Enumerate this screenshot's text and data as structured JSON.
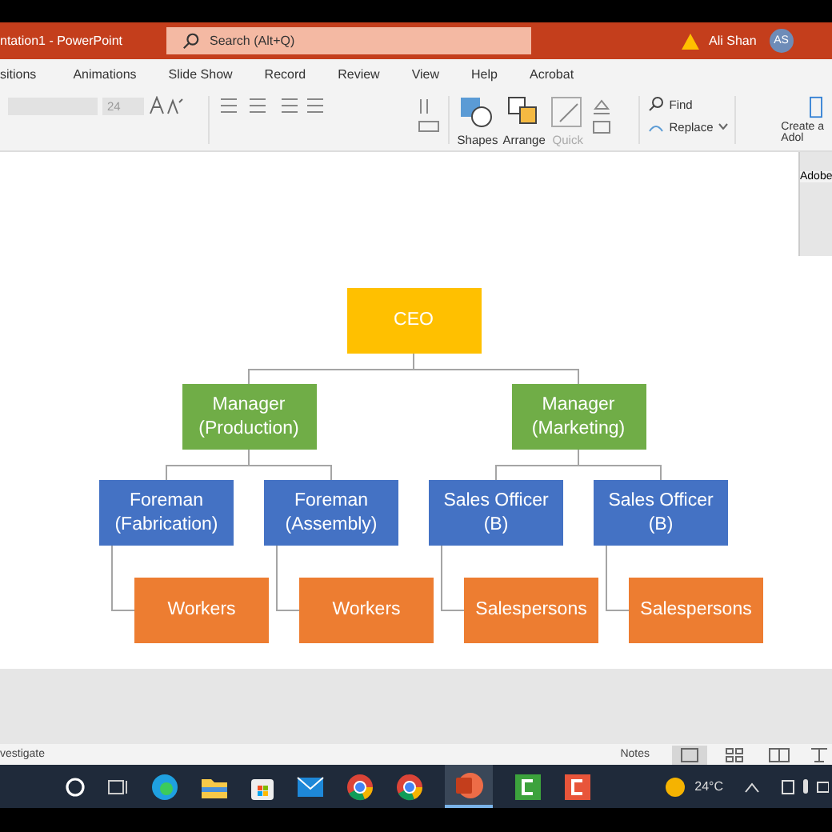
{
  "title_bar": {
    "title": "ntation1  -  PowerPoint",
    "search": {
      "placeholder": "Search (Alt+Q)"
    },
    "user": "Ali Shan",
    "avatar": "AS"
  },
  "tabs": [
    {
      "label": "sitions",
      "selected": false
    },
    {
      "label": "Animations",
      "selected": false
    },
    {
      "label": "Slide Show",
      "selected": false
    },
    {
      "label": "Record",
      "selected": false
    },
    {
      "label": "Review",
      "selected": false
    },
    {
      "label": "View",
      "selected": false
    },
    {
      "label": "Help",
      "selected": false
    },
    {
      "label": "Acrobat",
      "selected": false
    }
  ],
  "ribbon": {
    "font_size": "24",
    "shapes": "Shapes",
    "arrange": "Arrange",
    "quick": {
      "label": "Quick",
      "disabled": true
    },
    "find": "Find",
    "replace": "Replace",
    "create": "Create a",
    "create_line2": "Adol"
  },
  "side_panel": {
    "title": "Adobe"
  },
  "org_chart": {
    "label": "CEO",
    "children": [
      {
        "label": "Manager\n(Production)",
        "children": [
          {
            "label": "Foreman\n(Fabrication)",
            "children": [
              {
                "label": "Workers"
              }
            ]
          },
          {
            "label": "Foreman\n(Assembly)",
            "children": [
              {
                "label": "Workers"
              }
            ]
          }
        ]
      },
      {
        "label": "Manager\n(Marketing)",
        "children": [
          {
            "label": "Sales Officer\n(B)",
            "children": [
              {
                "label": "Salespersons"
              }
            ]
          },
          {
            "label": "Sales Officer\n(B)",
            "children": [
              {
                "label": "Salespersons"
              }
            ]
          }
        ]
      }
    ]
  },
  "status_bar": {
    "left": "vestigate",
    "notes": "Notes"
  },
  "taskbar": {
    "apps": [
      {
        "kind": "search"
      },
      {
        "kind": "taskview"
      },
      {
        "kind": "edge"
      },
      {
        "kind": "folder"
      },
      {
        "kind": "store"
      },
      {
        "kind": "mail"
      },
      {
        "kind": "chrome"
      },
      {
        "kind": "chrome"
      },
      {
        "kind": "powerpoint",
        "selected": true
      },
      {
        "kind": "green-c"
      },
      {
        "kind": "orange-c"
      }
    ],
    "temperature": "24°C"
  }
}
